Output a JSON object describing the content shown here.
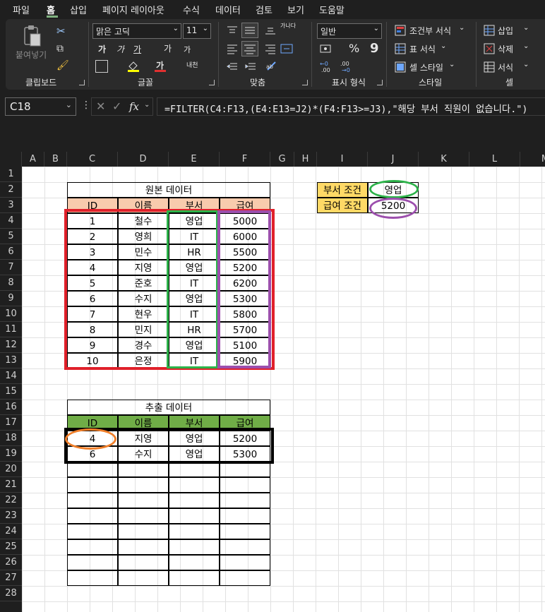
{
  "menu": {
    "tabs": [
      "파일",
      "홈",
      "삽입",
      "페이지 레이아웃",
      "수식",
      "데이터",
      "검토",
      "보기",
      "도움말"
    ],
    "active": "홈"
  },
  "ribbon": {
    "clipboard": {
      "paste": "붙여넣기",
      "label": "클립보드"
    },
    "font": {
      "name": "맑은 고딕",
      "size": "11",
      "bold": "가",
      "italic": "가",
      "underline": "가",
      "grow": "가",
      "shrink": "가",
      "color": "가",
      "phonetic": "내천",
      "label": "글꼴"
    },
    "alignment": {
      "wrap": "가나다",
      "label": "맞춤"
    },
    "number": {
      "format": "일반",
      "label": "표시 형식"
    },
    "styles": {
      "conditional": "조건부 서식",
      "table": "표 서식",
      "cell": "셀 스타일",
      "label": "스타일"
    },
    "cells": {
      "insert": "삽입",
      "delete": "삭제",
      "format": "서식",
      "label": "셀"
    }
  },
  "formula_bar": {
    "name_box": "C18",
    "formula": "=FILTER(C4:F13,(E4:E13=J2)*(F4:F13>=J3),\"해당 부서 직원이 없습니다.\")",
    "fx": "fx"
  },
  "columns": [
    "A",
    "B",
    "C",
    "D",
    "E",
    "F",
    "G",
    "H",
    "I",
    "J",
    "K",
    "L",
    "M"
  ],
  "rows": [
    "1",
    "2",
    "3",
    "4",
    "5",
    "6",
    "7",
    "8",
    "9",
    "10",
    "11",
    "12",
    "13",
    "14",
    "15",
    "16",
    "17",
    "18",
    "19",
    "20",
    "21",
    "22",
    "23",
    "24",
    "25",
    "26",
    "27",
    "28"
  ],
  "source_table": {
    "title": "원본 데이터",
    "headers": [
      "ID",
      "이름",
      "부서",
      "급여"
    ],
    "rows": [
      [
        "1",
        "철수",
        "영업",
        "5000"
      ],
      [
        "2",
        "영희",
        "IT",
        "6000"
      ],
      [
        "3",
        "민수",
        "HR",
        "5500"
      ],
      [
        "4",
        "지영",
        "영업",
        "5200"
      ],
      [
        "5",
        "준호",
        "IT",
        "6200"
      ],
      [
        "6",
        "수지",
        "영업",
        "5300"
      ],
      [
        "7",
        "현우",
        "IT",
        "5800"
      ],
      [
        "8",
        "민지",
        "HR",
        "5700"
      ],
      [
        "9",
        "경수",
        "영업",
        "5100"
      ],
      [
        "10",
        "은정",
        "IT",
        "5900"
      ]
    ]
  },
  "criteria": {
    "dept_label": "부서 조건",
    "dept_value": "영업",
    "salary_label": "급여 조건",
    "salary_value": "5200"
  },
  "result_table": {
    "title": "추출 데이터",
    "headers": [
      "ID",
      "이름",
      "부서",
      "급여"
    ],
    "rows": [
      [
        "4",
        "지영",
        "영업",
        "5200"
      ],
      [
        "6",
        "수지",
        "영업",
        "5300"
      ]
    ]
  },
  "colors": {
    "source_header": "#f8cbad",
    "result_header": "#70ad47",
    "criteria_label": "#ffd966",
    "red": "#e0202a",
    "green": "#2db34a",
    "purple": "#9c4fad",
    "orange": "#f07f2a"
  }
}
